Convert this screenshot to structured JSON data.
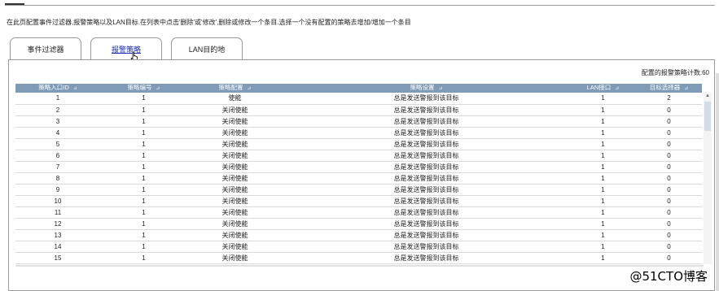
{
  "header": {
    "instruction": "在此页配置事件过滤器,报警策略以及LAN目标.在列表中点击'删除'或'修改',删除或修改一个条目.选择一个没有配置的策略去增加/增加一个条目"
  },
  "tabs": [
    {
      "label": "事件过滤器",
      "active": false
    },
    {
      "label": "报警策略",
      "active": true
    },
    {
      "label": "LAN目的地",
      "active": false
    }
  ],
  "panel": {
    "count_label": "配置的报警策略计数:60"
  },
  "table": {
    "columns": [
      "策略入口ID",
      "策略编号",
      "策略配置",
      "策略设置",
      "LAN接口",
      "目标选择器"
    ],
    "rows": [
      [
        "1",
        "1",
        "使能",
        "总是发送警报到该目标",
        "1",
        "2"
      ],
      [
        "2",
        "1",
        "关闭使能",
        "总是发送警报到该目标",
        "1",
        "0"
      ],
      [
        "3",
        "1",
        "关闭使能",
        "总是发送警报到该目标",
        "1",
        "0"
      ],
      [
        "4",
        "1",
        "关闭使能",
        "总是发送警报到该目标",
        "1",
        "0"
      ],
      [
        "5",
        "1",
        "关闭使能",
        "总是发送警报到该目标",
        "1",
        "0"
      ],
      [
        "6",
        "1",
        "关闭使能",
        "总是发送警报到该目标",
        "1",
        "0"
      ],
      [
        "7",
        "1",
        "关闭使能",
        "总是发送警报到该目标",
        "1",
        "0"
      ],
      [
        "8",
        "1",
        "关闭使能",
        "总是发送警报到该目标",
        "1",
        "0"
      ],
      [
        "9",
        "1",
        "关闭使能",
        "总是发送警报到该目标",
        "1",
        "0"
      ],
      [
        "10",
        "1",
        "关闭使能",
        "总是发送警报到该目标",
        "1",
        "0"
      ],
      [
        "11",
        "1",
        "关闭使能",
        "总是发送警报到该目标",
        "1",
        "0"
      ],
      [
        "12",
        "1",
        "关闭使能",
        "总是发送警报到该目标",
        "1",
        "0"
      ],
      [
        "13",
        "1",
        "关闭使能",
        "总是发送警报到该目标",
        "1",
        "0"
      ],
      [
        "14",
        "1",
        "关闭使能",
        "总是发送警报到该目标",
        "1",
        "0"
      ],
      [
        "15",
        "1",
        "关闭使能",
        "总是发送警报到该目标",
        "1",
        "0"
      ]
    ]
  },
  "watermark": "@51CTO博客",
  "icons": {
    "sort": "sort-arrow-icon",
    "cursor": "hand-pointer-icon",
    "scroll_up": "scroll-up-icon"
  },
  "colors": {
    "header_bg": "#7f9bb7",
    "active_tab_text": "#1a2bb8",
    "scroll_thumb": "#d3dde9"
  }
}
